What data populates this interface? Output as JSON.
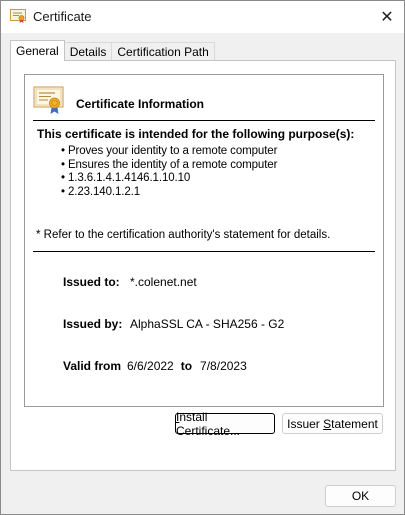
{
  "window": {
    "title": "Certificate",
    "close_glyph": "✕"
  },
  "tabs": [
    {
      "label": "General",
      "active": true
    },
    {
      "label": "Details",
      "active": false
    },
    {
      "label": "Certification Path",
      "active": false
    }
  ],
  "info": {
    "header": "Certificate Information",
    "purpose_title": "This certificate is intended for the following purpose(s):",
    "purposes": [
      "Proves your identity to a remote computer",
      "Ensures the identity of a remote computer",
      "1.3.6.1.4.1.4146.1.10.10",
      "2.23.140.1.2.1"
    ],
    "refer_note": "* Refer to the certification authority's statement for details.",
    "issued_to_label": "Issued to:",
    "issued_to_value": "*.colenet.net",
    "issued_by_label": "Issued by:",
    "issued_by_value": "AlphaSSL CA - SHA256 - G2",
    "valid_from_label": "Valid from",
    "valid_from_value": "6/6/2022",
    "valid_to_label": "to",
    "valid_to_value": "7/8/2023"
  },
  "buttons": {
    "install": {
      "pre": "",
      "accel": "I",
      "post": "nstall Certificate..."
    },
    "issuer": {
      "pre": "Issuer ",
      "accel": "S",
      "post": "tatement"
    },
    "ok": "OK"
  },
  "icons": {
    "title": "certificate-icon",
    "cert": "certificate-ribbon-icon",
    "close": "close-icon"
  }
}
